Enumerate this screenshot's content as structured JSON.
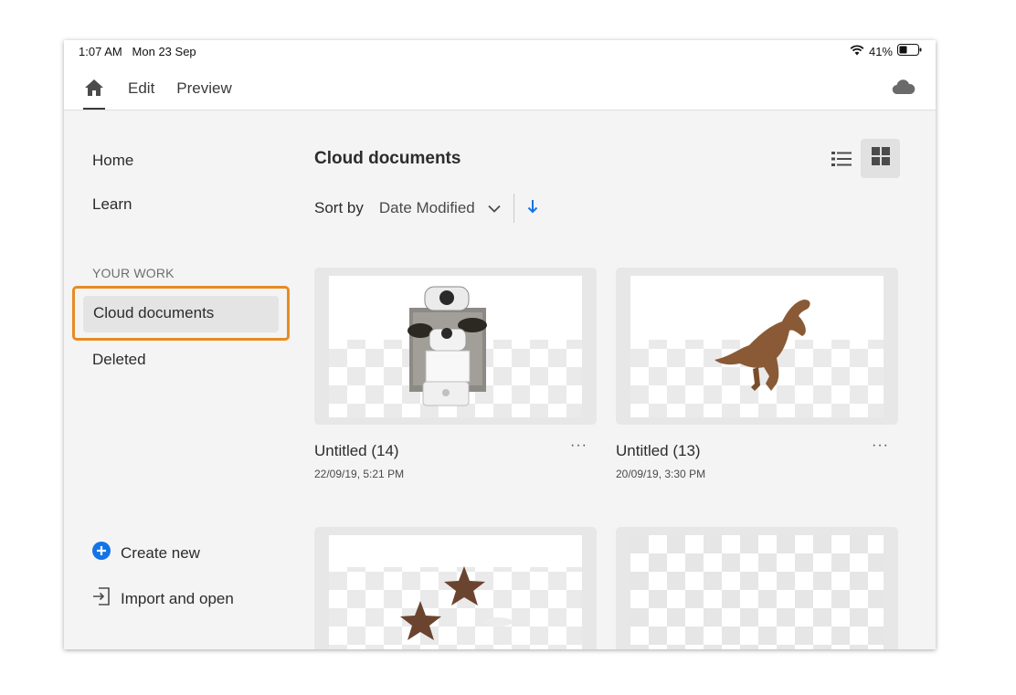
{
  "status_bar": {
    "time": "1:07 AM",
    "date": "Mon 23 Sep",
    "battery": "41%"
  },
  "nav": {
    "tabs": [
      {
        "label": "Edit"
      },
      {
        "label": "Preview"
      }
    ]
  },
  "sidebar": {
    "items": [
      {
        "label": "Home"
      },
      {
        "label": "Learn"
      }
    ],
    "section_label": "YOUR WORK",
    "work_items": [
      {
        "label": "Cloud documents",
        "selected": true
      },
      {
        "label": "Deleted"
      }
    ],
    "actions": {
      "create_new": "Create new",
      "import_open": "Import and open"
    }
  },
  "main": {
    "title": "Cloud documents",
    "sort": {
      "label": "Sort by",
      "value": "Date Modified",
      "direction": "descending"
    },
    "documents": [
      {
        "name": "Untitled (14)",
        "date": "22/09/19, 5:21 PM",
        "more": "···"
      },
      {
        "name": "Untitled (13)",
        "date": "20/09/19, 3:30 PM",
        "more": "···"
      },
      {
        "name": "",
        "date": ""
      },
      {
        "name": "",
        "date": ""
      }
    ]
  },
  "colors": {
    "highlight": "#e68c23",
    "accent_blue": "#1473e6",
    "background": "#f4f4f4"
  },
  "icons": [
    "home-icon",
    "cloud-icon",
    "wifi-icon",
    "battery-icon",
    "list-view-icon",
    "grid-view-icon",
    "chevron-down-icon",
    "sort-arrow-down-icon",
    "plus-circle-icon",
    "import-icon",
    "more-icon"
  ]
}
